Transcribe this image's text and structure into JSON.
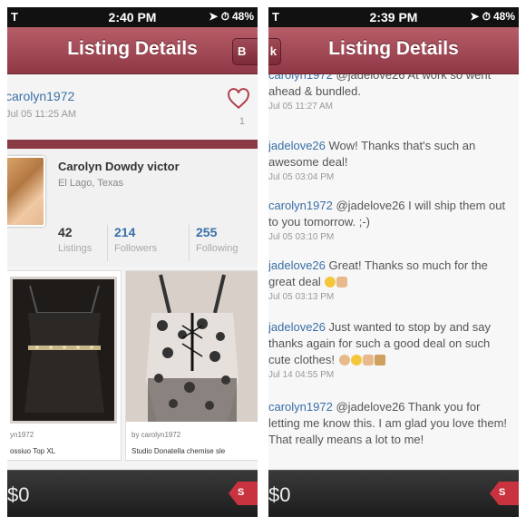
{
  "left": {
    "status": {
      "carrier": "T",
      "time": "2:40 PM",
      "battery": "48"
    },
    "nav": {
      "title": "Listing Details",
      "button": "B"
    },
    "listing": {
      "username": "carolyn1972",
      "date": "Jul 05 11:25 AM",
      "like_count": "1"
    },
    "profile": {
      "name": "Carolyn Dowdy victor",
      "location": "El Lago, Texas",
      "stats": [
        {
          "value": "42",
          "label": "Listings"
        },
        {
          "value": "214",
          "label": "Followers"
        },
        {
          "value": "255",
          "label": "Following"
        }
      ]
    },
    "items": [
      {
        "by": "yn1972",
        "title": "ossiuo Top XL"
      },
      {
        "by": "by carolyn1972",
        "title": "Studio Donatella chemise sle"
      }
    ],
    "bottom": {
      "price": "$0",
      "tag": "S"
    }
  },
  "right": {
    "status": {
      "carrier": "T",
      "time": "2:39 PM",
      "battery": "48"
    },
    "nav": {
      "title": "Listing Details",
      "button": "k"
    },
    "comments": [
      {
        "user": "carolyn1972",
        "text": "@jadelove26 At work so went ahead & bundled.",
        "date": "Jul 05 11:27 AM"
      },
      {
        "user": "jadelove26",
        "text": "Wow! Thanks that's such an awesome deal!",
        "date": "Jul 05 03:04 PM"
      },
      {
        "user": "carolyn1972",
        "text": "@jadelove26 I will ship them out to you tomorrow. ;-)",
        "date": "Jul 05 03:10 PM"
      },
      {
        "user": "jadelove26",
        "text": "Great! Thanks so much for the great deal",
        "date": "Jul 05 03:13 PM"
      },
      {
        "user": "jadelove26",
        "text": "Just wanted to stop by and say thanks again for such a good deal on such cute clothes!",
        "date": "Jul 14 04:55 PM"
      },
      {
        "user": "carolyn1972",
        "text": "@jadelove26 Thank you for letting me know this. I am glad you love them! That really means a lot to me!",
        "date": ""
      }
    ],
    "bottom": {
      "price": "$0",
      "tag": "S"
    }
  },
  "colors": {
    "nav": "#a14a56",
    "link": "#3a6fa8",
    "tag": "#c9333f"
  }
}
